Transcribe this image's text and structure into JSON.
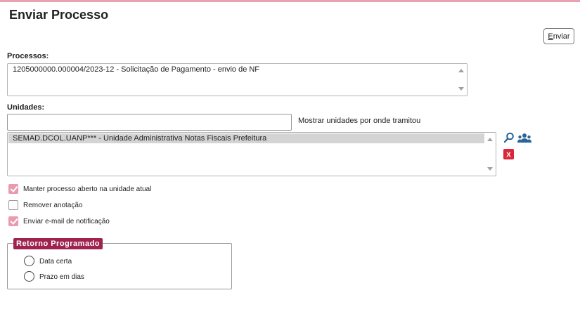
{
  "page": {
    "title": "Enviar Processo"
  },
  "toolbar": {
    "enviar_prefix": "",
    "enviar_underline": "E",
    "enviar_rest": "nviar"
  },
  "processos": {
    "label": "Processos:",
    "items": [
      "1205000000.000004/2023-12 - Solicitação de Pagamento - envio de NF"
    ]
  },
  "unidades": {
    "label": "Unidades:",
    "input_value": "",
    "mostrar_label": "Mostrar unidades por onde tramitou",
    "items": [
      "SEMAD.DCOL.UANP*** - Unidade Administrativa Notas Fiscais Prefeitura"
    ],
    "icons": {
      "search": "search-icon",
      "group": "users-group-icon",
      "remove": "remove-x-icon"
    }
  },
  "options": [
    {
      "label": "Manter processo aberto na unidade atual",
      "checked": true
    },
    {
      "label": "Remover anotação",
      "checked": false
    },
    {
      "label": "Enviar e-mail de notificação",
      "checked": true
    }
  ],
  "retorno": {
    "legend": "Retorno Programado",
    "options": [
      {
        "label": "Data certa",
        "selected": false
      },
      {
        "label": "Prazo em dias",
        "selected": false
      }
    ]
  },
  "colors": {
    "accent": "#a0224e",
    "checkbox": "#eb9aae",
    "icon_blue": "#2a6496",
    "remove_red": "#d9263a"
  }
}
